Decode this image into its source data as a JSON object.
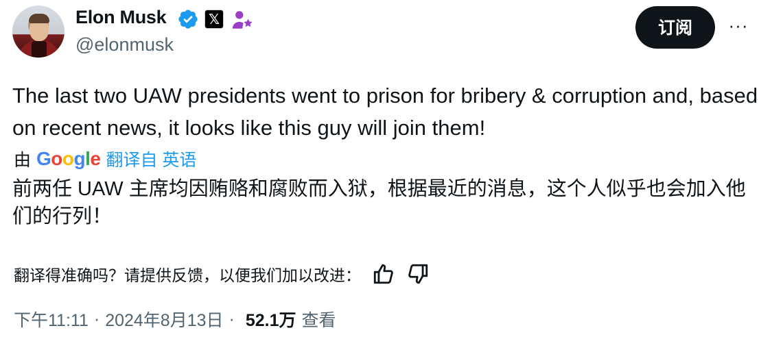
{
  "author": {
    "name": "Elon Musk",
    "handle": "@elonmusk",
    "avatar_icon": "profile-photo",
    "verified_badge_color": "#1d9bf0",
    "x_badge": "𝕏"
  },
  "actions": {
    "subscribe_label": "订阅",
    "more_label": "···"
  },
  "tweet": {
    "text": "The last two UAW presidents went to prison for bribery & corruption and, based on recent news, it looks like this guy will join them!"
  },
  "translation": {
    "by_label": "由",
    "provider": "Google",
    "link_label": "翻译自 英语",
    "text": "前两任 UAW 主席均因贿赂和腐败而入狱，根据最近的消息，这个人似乎也会加入他们的行列！",
    "feedback_prompt": "翻译得准确吗？请提供反馈，以便我们加以改进：",
    "feedback_icons": [
      "thumbs-up-icon",
      "thumbs-down-icon"
    ]
  },
  "meta": {
    "time": "下午11:11",
    "separator": "·",
    "date": "2024年8月13日",
    "views_count": "52.1万",
    "views_label": "查看"
  },
  "colors": {
    "text": "#0f1419",
    "secondary": "#536471",
    "link": "#1d9bf0",
    "button_bg": "#0f1419",
    "affiliate_purple": "#9b3fc7"
  }
}
